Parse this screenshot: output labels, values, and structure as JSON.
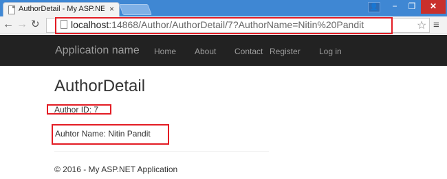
{
  "browser": {
    "tab_title": "AuthorDetail - My ASP.NE",
    "tab_close": "×",
    "url_host": "localhost",
    "url_rest": ":14868/Author/AuthorDetail/7?AuthorName=Nitin%20Pandit",
    "window_controls": {
      "user": "👤",
      "minimize": "−",
      "maximize": "❐",
      "close": "✕"
    }
  },
  "navbar": {
    "brand": "Application name",
    "links": [
      "Home",
      "About",
      "Contact",
      "Register",
      "Log in"
    ]
  },
  "main": {
    "title": "AuthorDetail",
    "author_id": "Author ID: 7",
    "author_name": "Auhtor Name: Nitin Pandit"
  },
  "footer": {
    "text": "© 2016 - My ASP.NET Application"
  },
  "colors": {
    "highlight": "#e31b23",
    "navbar_bg": "#222222",
    "titlebar": "#3f87d3"
  }
}
